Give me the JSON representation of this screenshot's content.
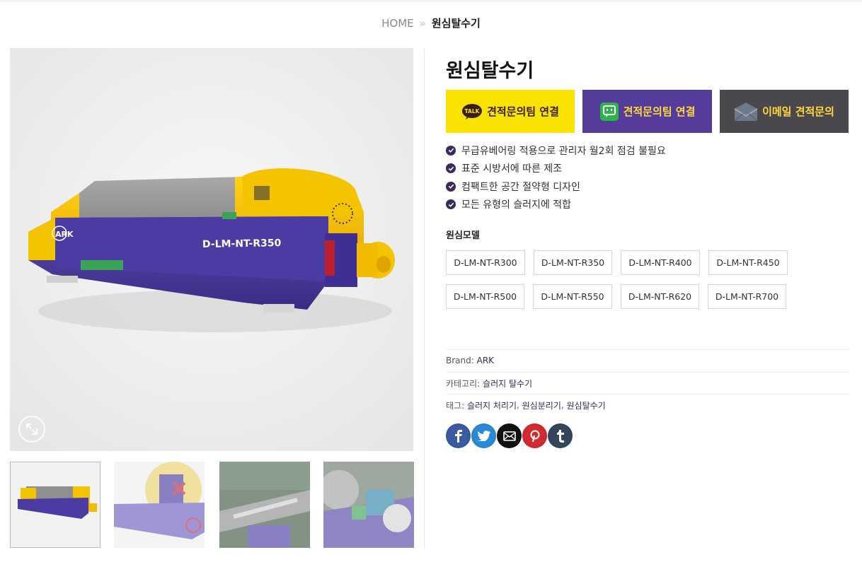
{
  "breadcrumb": {
    "home": "HOME",
    "separator": "»",
    "current": "원심탈수기"
  },
  "product": {
    "title": "원심탈수기",
    "image_model_text": "D-LM-NT-R350",
    "image_logo_text": "ARK"
  },
  "cta": {
    "kakao": {
      "badge": "TALK",
      "label": "견적문의팀 연결",
      "icon": "kakaotalk-icon"
    },
    "talk": {
      "label": "견적문의팀 연결",
      "icon": "chat-bubble-icon"
    },
    "email": {
      "label": "이메일 견적문의",
      "icon": "envelope-icon"
    }
  },
  "features": [
    "무급유베어링 적용으로 관리자 월2회 점검 불필요",
    "표준 시방서에 따른 제조",
    "컴팩트한 공간 절약형 디자인",
    "모든 유형의 슬러지에 적합"
  ],
  "models": {
    "label": "원심모델",
    "options": [
      "D-LM-NT-R300",
      "D-LM-NT-R350",
      "D-LM-NT-R400",
      "D-LM-NT-R450",
      "D-LM-NT-R500",
      "D-LM-NT-R550",
      "D-LM-NT-R620",
      "D-LM-NT-R700"
    ]
  },
  "meta": {
    "brand_label": "Brand:",
    "brand_value": "ARK",
    "category_label": "카테고리:",
    "category_value": "슬러지 탈수기",
    "tags_label": "태그:",
    "tags": [
      "슬러지 처리기",
      "원심분리기",
      "원심탈수기"
    ]
  },
  "social": [
    "facebook-icon",
    "twitter-icon",
    "email-icon",
    "pinterest-icon",
    "tumblr-icon"
  ],
  "colors": {
    "kakao": "#fae300",
    "talk": "#553c9a",
    "email": "#4a474d",
    "accent": "#3c2a5c",
    "machine_purple": "#4a3a9e",
    "machine_yellow": "#f5c400"
  }
}
